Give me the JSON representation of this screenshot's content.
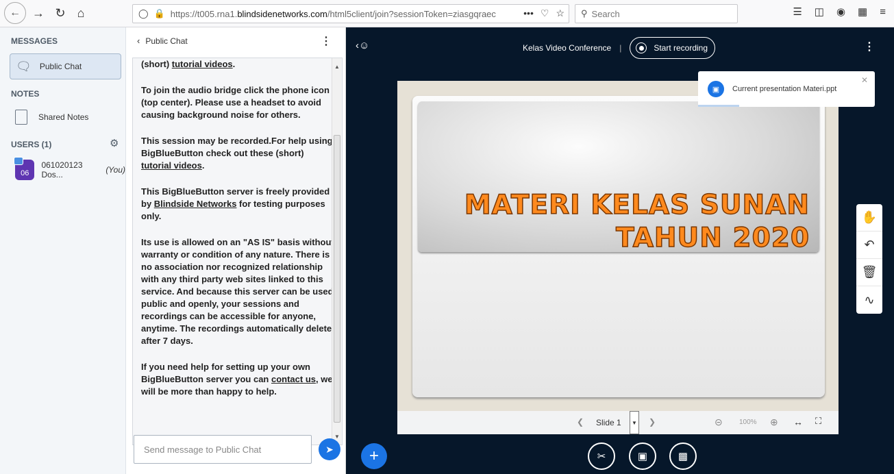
{
  "browser": {
    "url_prefix": "https://t005.rna1.",
    "url_domain": "blindsidenetworks.com",
    "url_suffix": "/html5client/join?sessionToken=ziasgqraec",
    "search_placeholder": "Search"
  },
  "sidebar": {
    "messages_label": "MESSAGES",
    "public_chat_label": "Public Chat",
    "notes_label": "NOTES",
    "shared_notes_label": "Shared Notes",
    "users_label": "USERS (1)",
    "user": {
      "initials": "06",
      "name": "061020123 Dos...",
      "you": "(You)"
    }
  },
  "chat": {
    "title": "Public Chat",
    "messages": {
      "m0_prefix": "(short) ",
      "m0_link": "tutorial videos",
      "m0_end": ".",
      "m1_a": "To join the audio bridge click the phone icon (top center). ",
      "m1_b": "Please use a headset to avoid causing background noise for others.",
      "m2_a": "This session may be recorded.For help using BigBlueButton check out these (short) ",
      "m2_link": "tutorial videos",
      "m2_end": ".",
      "m3_a": "This BigBlueButton server is freely provided by ",
      "m3_link": "Blindside Networks",
      "m3_b": " for testing purposes only.",
      "m4": "Its use is allowed on an \"AS IS\" basis without warranty or condition of any nature. There is no association nor recognized relationship with any third party web sites linked to this service. And because this server can be used public and openly, your sessions and recordings can be accessible for anyone, anytime. The recordings automatically delete after 7 days.",
      "m5_a": "If you need help for setting up your own BigBlueButton server you can ",
      "m5_link": "contact us",
      "m5_b": ", we will be more than happy to help."
    },
    "input_placeholder": "Send message to Public Chat"
  },
  "main": {
    "conference_title": "Kelas Video Conference",
    "record_label": "Start recording",
    "slide_title_line1": "MATERI KELAS SUNAN",
    "slide_title_line2": "TAHUN 2020",
    "slide_label": "Slide 1",
    "zoom": "100%",
    "toast_text": "Current presentation Materi.ppt"
  }
}
